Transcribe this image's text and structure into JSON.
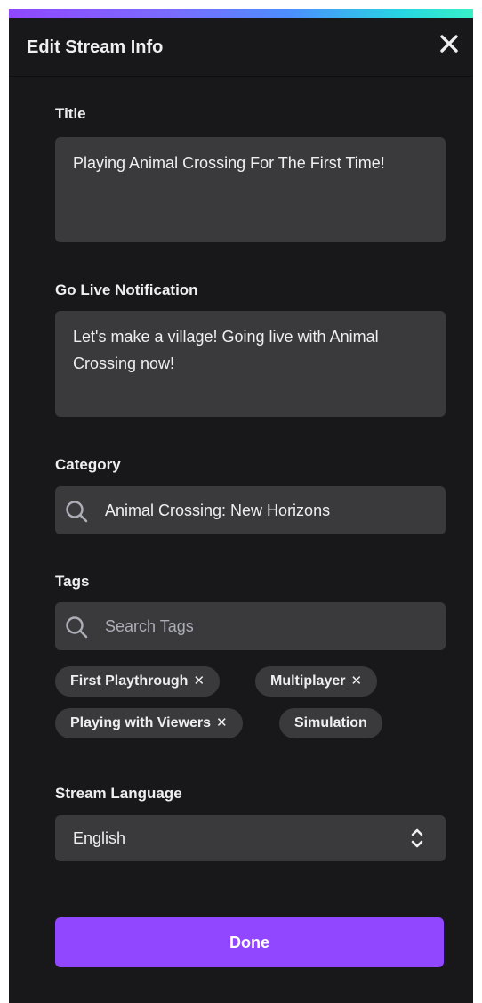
{
  "colors": {
    "panel_bg": "#18181b",
    "field_bg": "#3a3a3d",
    "accent": "#9147ff",
    "text": "#efeff1",
    "muted_text": "#adadb8"
  },
  "header": {
    "title": "Edit Stream Info",
    "close_icon": "close-icon"
  },
  "title_field": {
    "label": "Title",
    "value": "Playing Animal Crossing For The First Time!"
  },
  "notification_field": {
    "label": "Go Live Notification",
    "value": "Let's make a village! Going live with Animal Crossing now!"
  },
  "category_field": {
    "label": "Category",
    "icon": "search-icon",
    "value": "Animal Crossing: New Horizons"
  },
  "tags_field": {
    "label": "Tags",
    "icon": "search-icon",
    "placeholder": "Search Tags",
    "tags": [
      {
        "label": "First Playthrough",
        "removable": true,
        "remove_glyph": "✕"
      },
      {
        "label": "Multiplayer",
        "removable": true,
        "remove_glyph": "✕"
      },
      {
        "label": "Playing with Viewers",
        "removable": true,
        "remove_glyph": "✕"
      },
      {
        "label": "Simulation",
        "removable": false
      }
    ]
  },
  "language_field": {
    "label": "Stream Language",
    "value": "English",
    "icon": "chevron-updown-icon"
  },
  "done_button": {
    "label": "Done"
  }
}
